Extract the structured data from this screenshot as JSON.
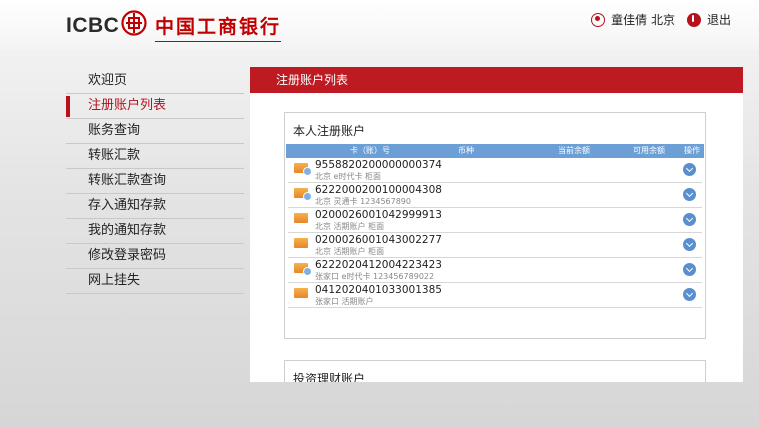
{
  "header": {
    "logo_text": "ICBC",
    "logo_cn": "中国工商银行",
    "user": "童佳倩 北京",
    "logout": "退出"
  },
  "menu": {
    "items": [
      {
        "label": "欢迎页"
      },
      {
        "label": "注册账户列表",
        "active": true
      },
      {
        "label": "账务查询"
      },
      {
        "label": "转账汇款"
      },
      {
        "label": "转账汇款查询"
      },
      {
        "label": "存入通知存款"
      },
      {
        "label": "我的通知存款"
      },
      {
        "label": "修改登录密码"
      },
      {
        "label": "网上挂失"
      }
    ]
  },
  "main": {
    "title": "注册账户列表",
    "section1": {
      "title": "本人注册账户",
      "columns": [
        "卡（账）号",
        "币种",
        "当前余额",
        "可用余额",
        "操作"
      ],
      "rows": [
        {
          "account": "9558820200000000374",
          "sub": "北京 e时代卡 柜面",
          "icon": "multi-card-icon"
        },
        {
          "account": "6222000200100004308",
          "sub": "北京 灵通卡 1234567890",
          "icon": "multi-card-icon"
        },
        {
          "account": "0200026001042999913",
          "sub": "北京 活期账户 柜面",
          "icon": "card-icon"
        },
        {
          "account": "0200026001043002277",
          "sub": "北京 活期账户 柜面",
          "icon": "card-icon"
        },
        {
          "account": "6222020412004223423",
          "sub": "张家口 e时代卡 123456789022",
          "icon": "multi-card-icon"
        },
        {
          "account": "0412020401033001385",
          "sub": "张家口 活期账户",
          "icon": "card-icon"
        }
      ]
    },
    "section2": {
      "title": "投资理财账户"
    }
  },
  "colors": {
    "brand_red": "#be1a21",
    "table_header_blue": "#6b9fd6"
  }
}
